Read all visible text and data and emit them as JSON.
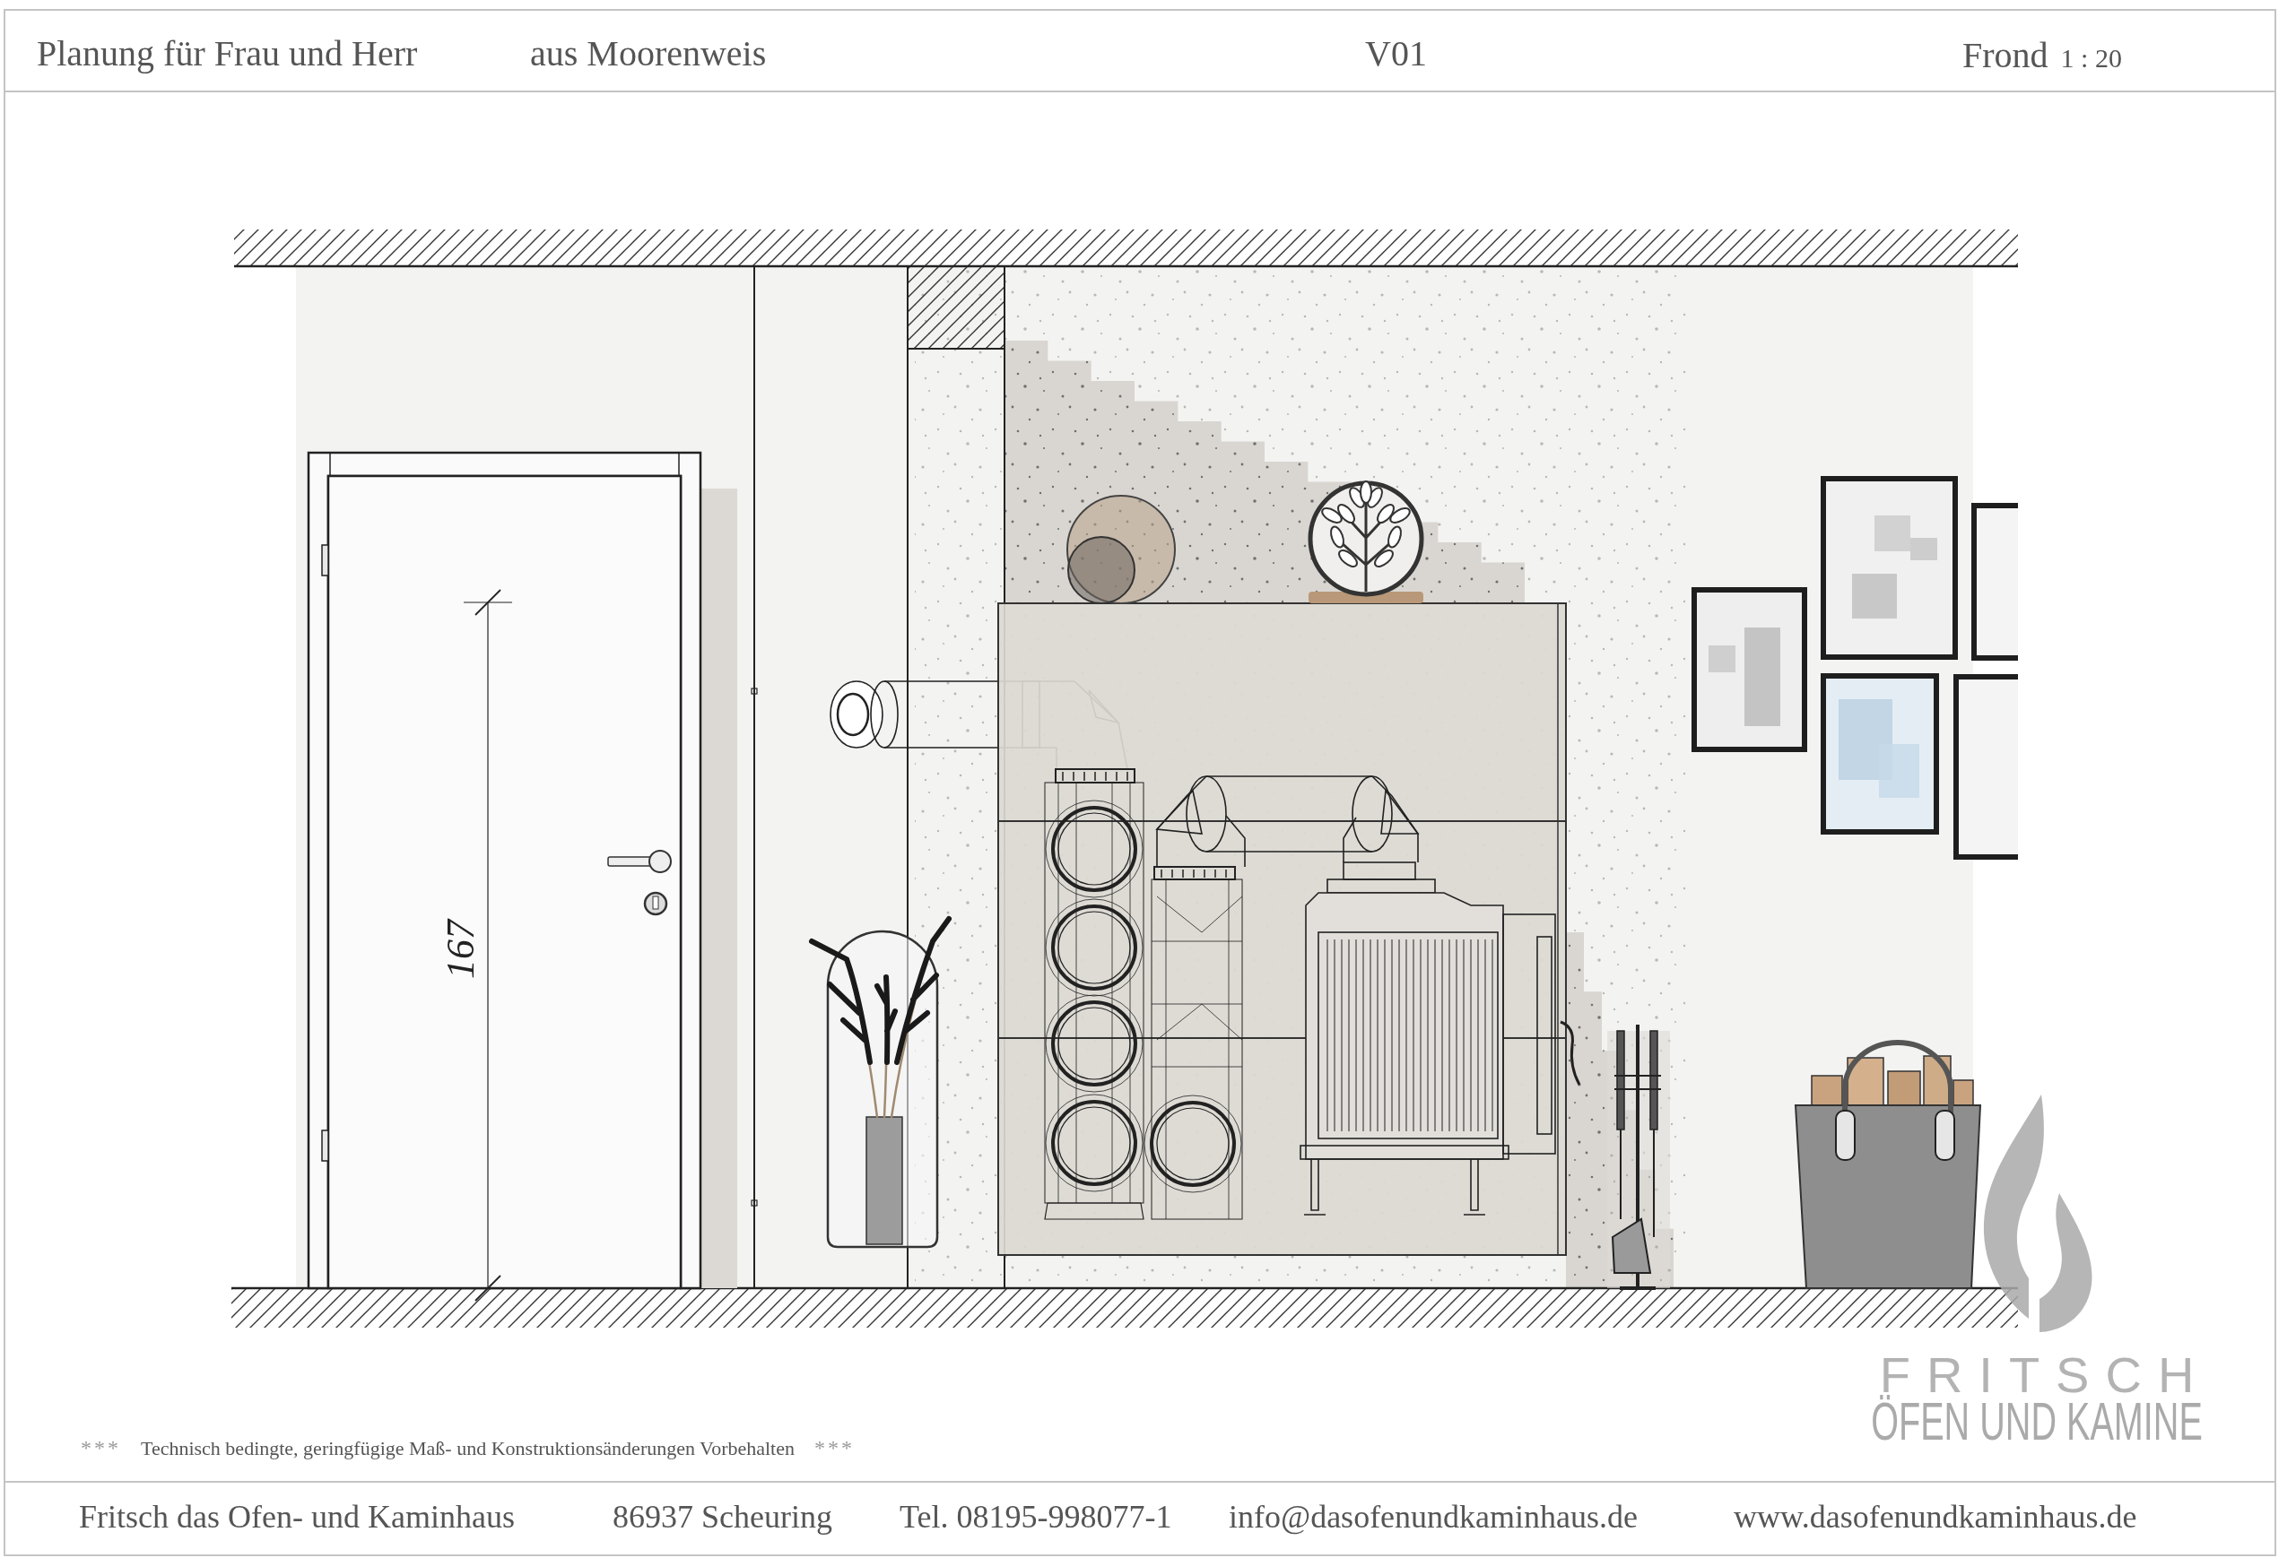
{
  "header": {
    "client": "Planung für Frau und Herr",
    "location": "aus Moorenweis",
    "version": "V01",
    "view": "Frond",
    "scale": "1 : 20"
  },
  "drawing": {
    "dimension": "167"
  },
  "disclaimer": {
    "mark_left": "***",
    "text": "Technisch bedingte, geringfügige Maß- und Konstruktionsänderungen Vorbehalten",
    "mark_right": "***"
  },
  "logo": {
    "name": "FRITSCH",
    "tagline": "ÖFEN UND KAMINE"
  },
  "footer": {
    "company": "Fritsch das Ofen- und Kaminhaus",
    "address": "86937 Scheuring",
    "phone": "Tel. 08195-998077-1",
    "email": "info@dasofenundkaminhaus.de",
    "website": "www.dasofenundkaminhaus.de"
  }
}
